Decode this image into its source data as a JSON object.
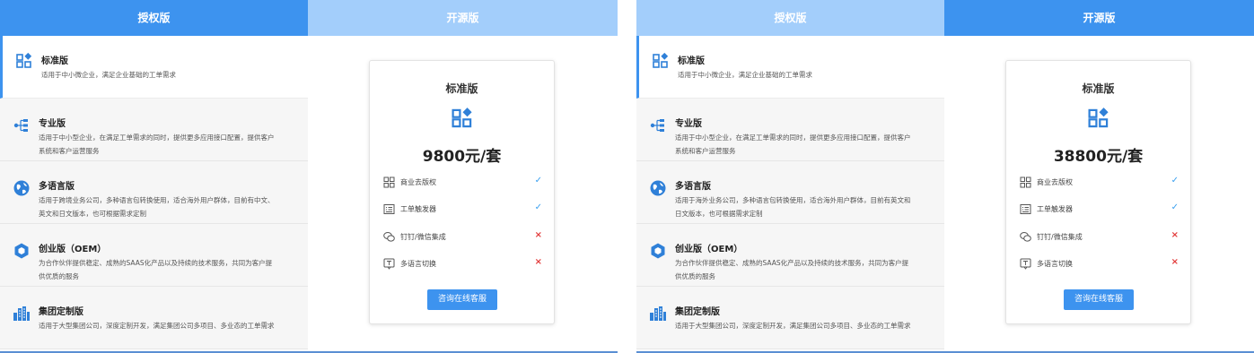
{
  "panels": [
    {
      "tabs": [
        {
          "label": "授权版",
          "active": true
        },
        {
          "label": "开源版",
          "active": false
        }
      ],
      "items": [
        {
          "name": "标准版",
          "desc_lines": [
            "适用于中小微企业，满足企业基础的工单需求"
          ],
          "icon": "cube-blocks-icon"
        },
        {
          "name": "专业版",
          "desc_lines": [
            "适用于中小型企业，在满足工单需求的同时，提供更多应用接口配置，提供客户",
            "系统和客户运营服务"
          ],
          "icon": "hierarchy-icon"
        },
        {
          "name": "多语言版",
          "desc_lines": [
            "适用于跨境业务公司，多种语言包转换使用，适合海外用户群体，目前有中文、",
            "英文和日文版本，也可根据需求定制"
          ],
          "icon": "globe-icon"
        },
        {
          "name": "创业版（OEM）",
          "desc_lines": [
            "为合作伙伴提供稳定、成熟的SAAS化产品以及持续的技术服务，共同为客户提",
            "供优质的服务"
          ],
          "icon": "hexagon-icon"
        },
        {
          "name": "集团定制版",
          "desc_lines": [
            "适用于大型集团公司，深度定制开发，满足集团公司多项目、多业态的工单需求"
          ],
          "icon": "buildings-icon"
        }
      ],
      "card": {
        "title": "标准版",
        "price": "9800元/套",
        "features": [
          {
            "label": "商业去版权",
            "included": "✓",
            "icon": "grid-icon"
          },
          {
            "label": "工单触发器",
            "included": "✓",
            "icon": "form-icon"
          },
          {
            "label": "钉钉/微信集成",
            "included": "×",
            "icon": "chat-icon"
          },
          {
            "label": "多语言切换",
            "included": "×",
            "icon": "translate-icon"
          }
        ],
        "button_label": "咨询在线客服"
      }
    },
    {
      "tabs": [
        {
          "label": "授权版",
          "active": false
        },
        {
          "label": "开源版",
          "active": true
        }
      ],
      "items": [
        {
          "name": "标准版",
          "desc_lines": [
            "适用于中小微企业，满足企业基础的工单需求"
          ],
          "icon": "cube-blocks-icon"
        },
        {
          "name": "专业版",
          "desc_lines": [
            "适用于中小型企业，在满足工单需求的同时，提供更多应用接口配置，提供客户",
            "系统和客户运营服务"
          ],
          "icon": "hierarchy-icon"
        },
        {
          "name": "多语言版",
          "desc_lines": [
            "适用于海外业务公司，多种语言包转换使用，适合海外用户群体，目前有英文和",
            "日文版本，也可根据需求定制"
          ],
          "icon": "globe-icon"
        },
        {
          "name": "创业版（OEM）",
          "desc_lines": [
            "为合作伙伴提供稳定、成熟的SAAS化产品以及持续的技术服务，共同为客户提",
            "供优质的服务"
          ],
          "icon": "hexagon-icon"
        },
        {
          "name": "集团定制版",
          "desc_lines": [
            "适用于大型集团公司，深度定制开发，满足集团公司多项目、多业态的工单需求"
          ],
          "icon": "buildings-icon"
        }
      ],
      "card": {
        "title": "标准版",
        "price": "38800元/套",
        "features": [
          {
            "label": "商业去版权",
            "included": "✓",
            "icon": "grid-icon"
          },
          {
            "label": "工单触发器",
            "included": "✓",
            "icon": "form-icon"
          },
          {
            "label": "钉钉/微信集成",
            "included": "×",
            "icon": "chat-icon"
          },
          {
            "label": "多语言切换",
            "included": "×",
            "icon": "translate-icon"
          }
        ],
        "button_label": "咨询在线客服"
      }
    }
  ],
  "colors": {
    "accent": "#3d93ef",
    "tab_inactive": "#a3cefb",
    "check": "#3aa0f0",
    "cross": "#e23a3a"
  }
}
